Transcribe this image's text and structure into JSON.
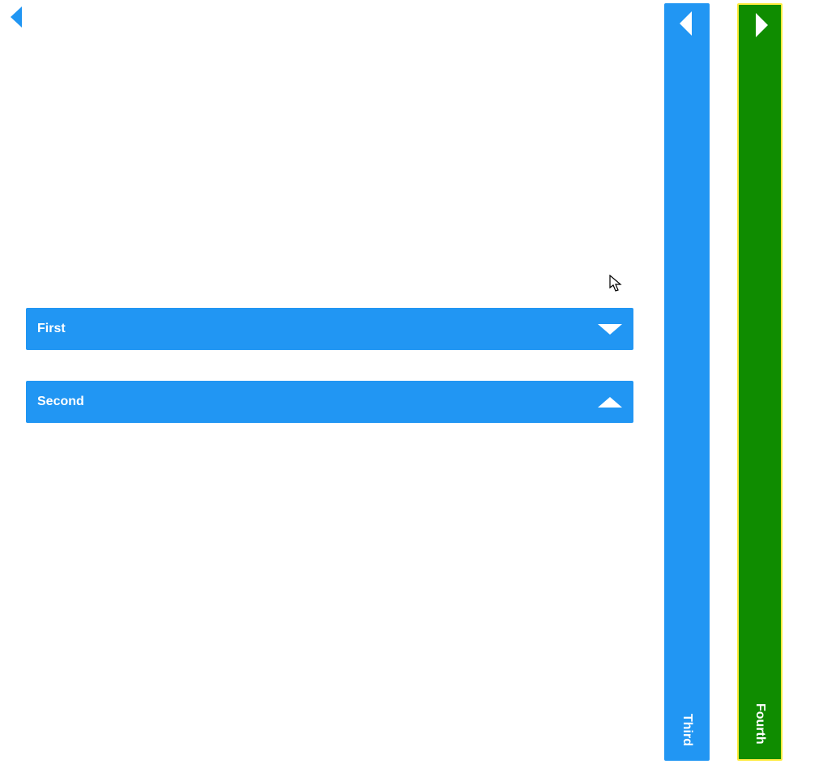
{
  "colors": {
    "blue": "#2196F3",
    "green": "#0F8C00",
    "yellow": "#FFEB3B",
    "white": "#ffffff"
  },
  "panels": {
    "first": {
      "label": "First",
      "expanded_icon": "triangle-down"
    },
    "second": {
      "label": "Second",
      "expanded_icon": "triangle-up"
    }
  },
  "columns": {
    "third": {
      "label": "Third",
      "arrow": "triangle-left"
    },
    "fourth": {
      "label": "Fourth",
      "arrow": "triangle-right"
    }
  },
  "topleft_icon": "triangle-left-blue"
}
